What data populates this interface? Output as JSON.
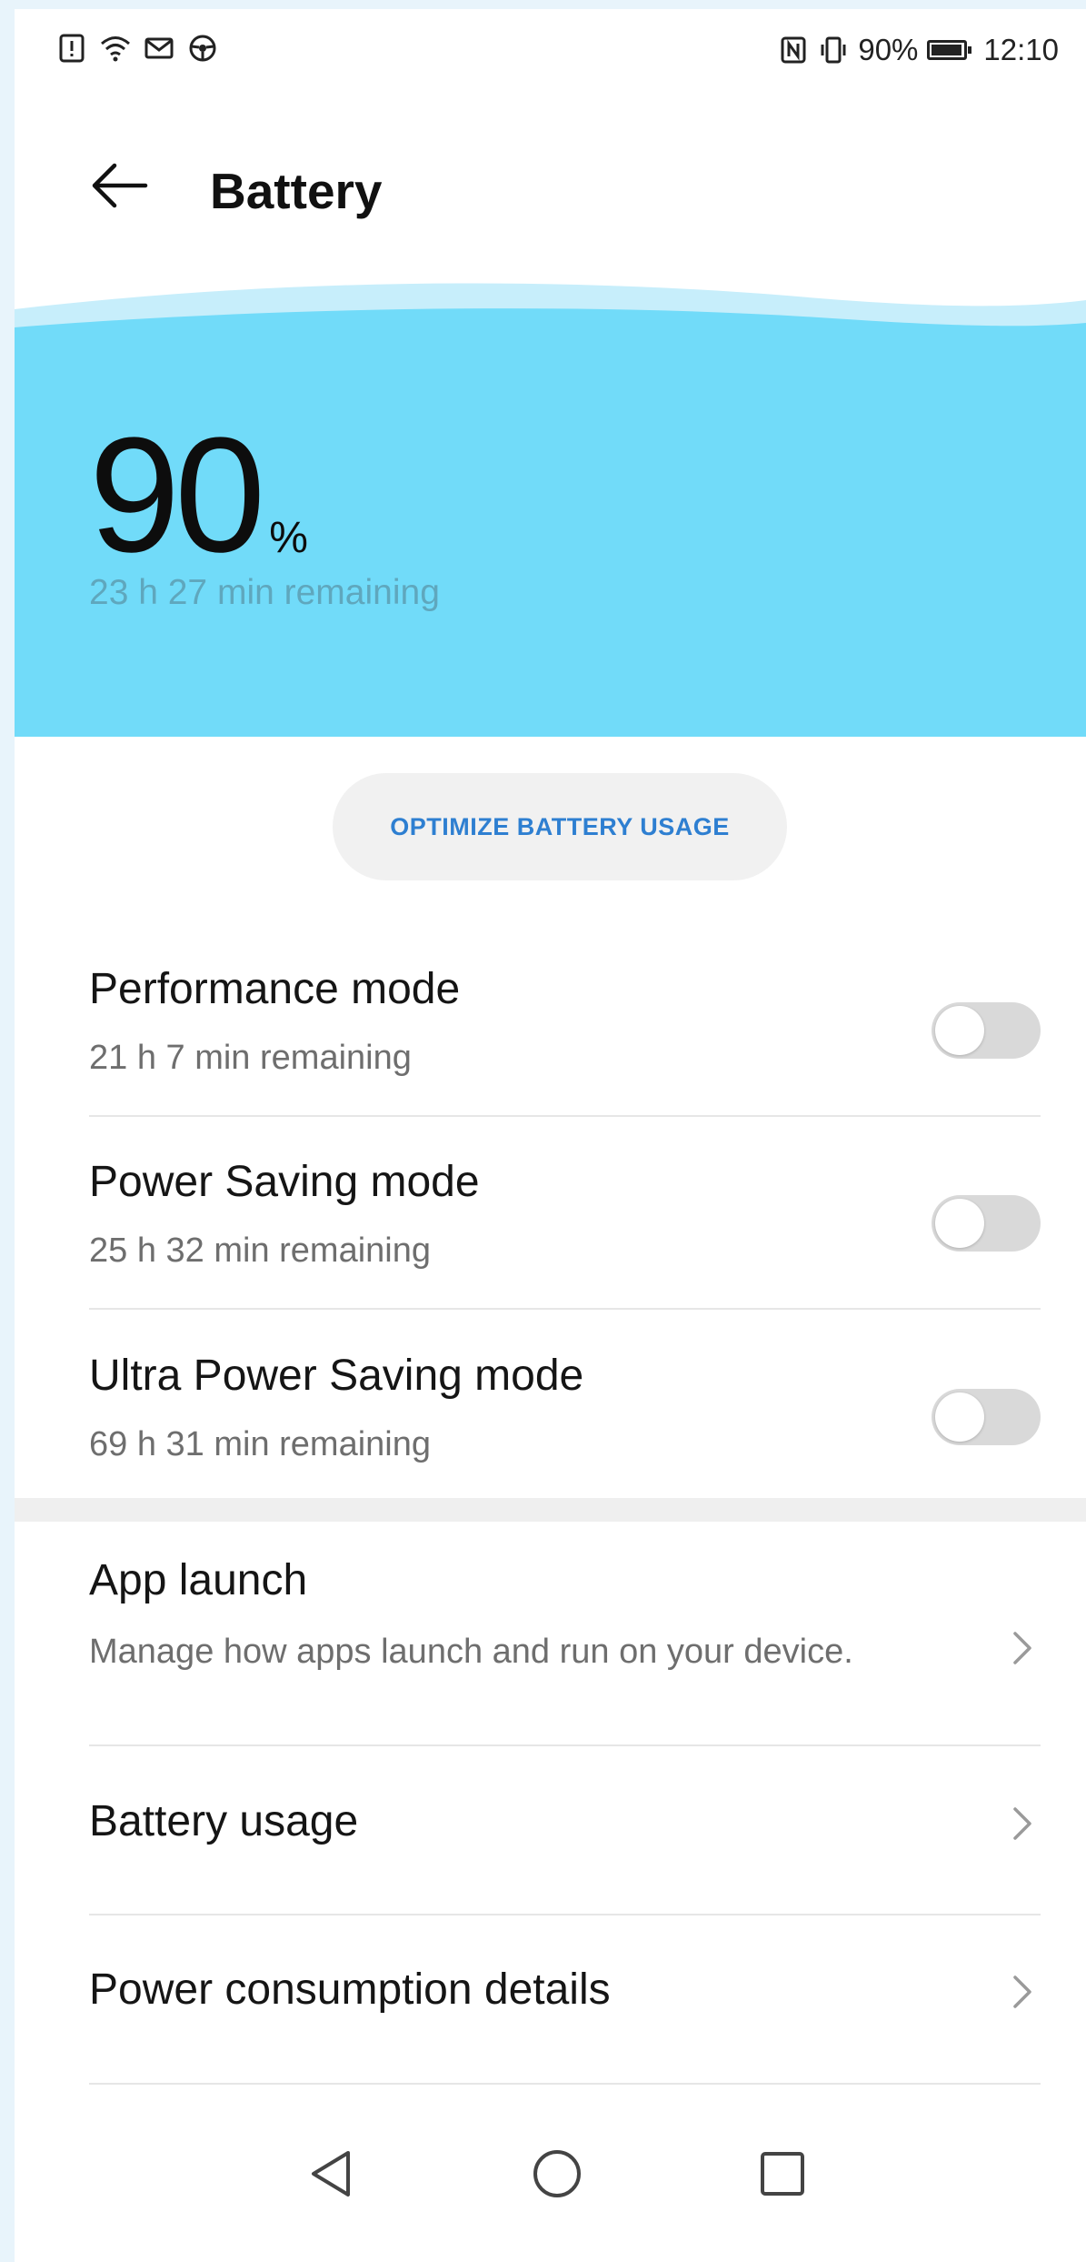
{
  "status_bar": {
    "left_icons": [
      "alert-icon",
      "wifi-icon",
      "mail-icon",
      "steering-wheel-icon"
    ],
    "right_icons": [
      "nfc-icon",
      "vibrate-icon"
    ],
    "battery_percent": "90%",
    "time": "12:10"
  },
  "header": {
    "back_icon": "arrow-left-icon",
    "title": "Battery"
  },
  "hero": {
    "percent_value": "90",
    "percent_unit": "%",
    "remaining": "23 h 27 min remaining",
    "color": "#71dbf9"
  },
  "optimize_button": {
    "label": "OPTIMIZE BATTERY USAGE",
    "color": "#2e7fd1"
  },
  "modes": [
    {
      "title": "Performance mode",
      "subtitle": "21 h 7 min remaining",
      "enabled": false
    },
    {
      "title": "Power Saving mode",
      "subtitle": "25 h 32 min remaining",
      "enabled": false
    },
    {
      "title": "Ultra Power Saving mode",
      "subtitle": "69 h 31 min remaining",
      "enabled": false
    }
  ],
  "settings": [
    {
      "title": "App launch",
      "subtitle": "Manage how apps launch and run on your device.",
      "icon": "chevron-right-icon"
    },
    {
      "title": "Battery usage",
      "icon": "chevron-right-icon"
    },
    {
      "title": "Power consumption details",
      "icon": "chevron-right-icon"
    }
  ],
  "nav_bar": {
    "buttons": [
      "back-triangle-icon",
      "home-circle-icon",
      "recents-square-icon"
    ]
  }
}
